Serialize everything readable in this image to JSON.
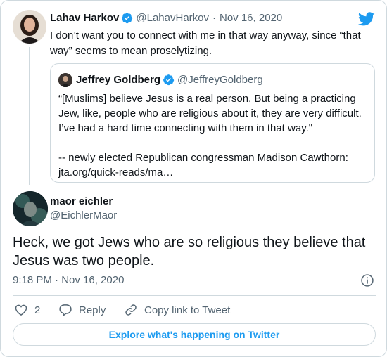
{
  "parent_tweet": {
    "name": "Lahav Harkov",
    "handle": "@LahavHarkov",
    "separator": "·",
    "date": "Nov 16, 2020",
    "text": "I don’t want you to connect with me in that way anyway, since “that way” seems to mean proselytizing."
  },
  "quoted_tweet": {
    "name": "Jeffrey Goldberg",
    "handle": "@JeffreyGoldberg",
    "line1": "“[Muslims] believe Jesus is a real person. But being a practicing Jew, like, people who are religious about it, they are very difficult. I’ve had a hard time connecting with them in that way.\"",
    "line2": "-- newly elected Republican congressman Madison Cawthorn: jta.org/quick-reads/ma…"
  },
  "main_tweet": {
    "name": "maor eichler",
    "handle": "@EichlerMaor",
    "text": "Heck, we got Jews who are so religious they believe that Jesus was two people.",
    "timestamp": "9:18 PM · Nov 16, 2020"
  },
  "actions": {
    "like_count": "2",
    "reply_label": "Reply",
    "copy_label": "Copy link to Tweet"
  },
  "explore_label": "Explore what's happening on Twitter",
  "icons": {
    "brand": "twitter-bird-icon",
    "verified": "verified-badge-icon",
    "info": "info-icon",
    "like": "heart-icon",
    "reply": "reply-bubble-icon",
    "copy": "link-icon"
  },
  "colors": {
    "accent": "#1d9bf0",
    "text": "#0f1419",
    "muted": "#536471",
    "border": "#cfd9de"
  }
}
